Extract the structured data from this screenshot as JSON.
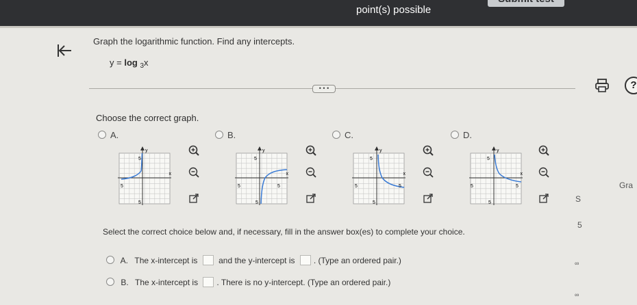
{
  "header": {
    "points_label": "point(s) possible",
    "submit_label": "Submit test"
  },
  "question": {
    "prompt": "Graph the logarithmic function. Find any intercepts.",
    "equation_prefix": "y = ",
    "equation_func": "log",
    "equation_base": "3",
    "equation_var": "x",
    "expand_label": "• • •",
    "choose_label": "Choose the correct graph."
  },
  "graph_options": [
    {
      "letter": "A.",
      "axis_x": "x",
      "axis_y": "y",
      "tick": "5"
    },
    {
      "letter": "B.",
      "axis_x": "x",
      "axis_y": "y",
      "tick": "5"
    },
    {
      "letter": "C.",
      "axis_x": "x",
      "axis_y": "y",
      "tick": "5"
    },
    {
      "letter": "D.",
      "axis_x": "x",
      "axis_y": "y",
      "tick": "5"
    }
  ],
  "intercepts": {
    "instruction": "Select the correct choice below and, if necessary, fill in the answer box(es) to complete your choice.",
    "option_a": {
      "letter": "A.",
      "text1": "The x-intercept is",
      "text2": "and the y-intercept is",
      "text3": ". (Type an ordered pair.)"
    },
    "option_b": {
      "letter": "B.",
      "text1": "The x-intercept is",
      "text2": ". There is no y-intercept. (Type an ordered pair.)"
    }
  },
  "sidebar_right": {
    "gra_label": "Gra",
    "s_label": "S",
    "five_label": "5",
    "inf_label_1": "∞",
    "inf_label_2": "∞"
  },
  "colors": {
    "topbar": "#2f3033",
    "curve": "#3a7bd5",
    "grid": "#c8c8c8"
  }
}
